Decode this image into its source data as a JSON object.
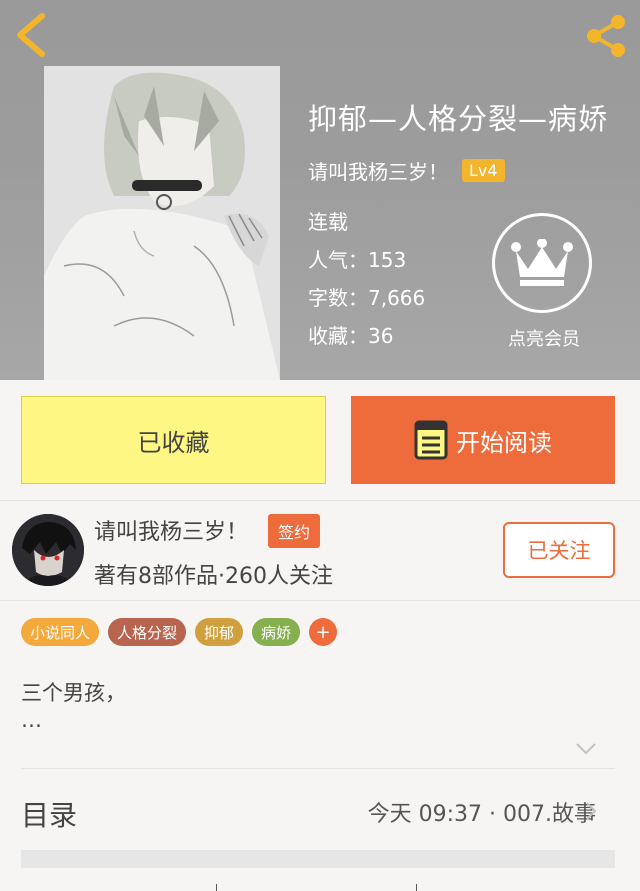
{
  "book": {
    "title": "抑郁—人格分裂—病娇",
    "author": "请叫我杨三岁！",
    "level": "Lv4",
    "status": "连载",
    "popularity": "人气：153",
    "word_count": "字数：7,666",
    "favorites": "收藏：36"
  },
  "vip": {
    "label": "点亮会员"
  },
  "actions": {
    "collect_label": "已收藏",
    "read_label": "开始阅读"
  },
  "writer": {
    "name": "请叫我杨三岁！",
    "badge": "签约",
    "meta": "著有8部作品·260人关注",
    "follow_label": "已关注"
  },
  "tags": [
    {
      "label": "小说同人",
      "color": "#f3a93c"
    },
    {
      "label": "人格分裂",
      "color": "#b8644f"
    },
    {
      "label": "抑郁",
      "color": "#d1a03e"
    },
    {
      "label": "病娇",
      "color": "#86b04e"
    }
  ],
  "tag_add": "+",
  "description": {
    "line1": "三个男孩，",
    "line2": "…"
  },
  "toc": {
    "label": "目录",
    "latest": "今天 09:37 · 007.故事"
  },
  "colors": {
    "accent": "#ee6b3b",
    "collect_bg": "#fef784",
    "level_badge": "#f3b52c"
  }
}
